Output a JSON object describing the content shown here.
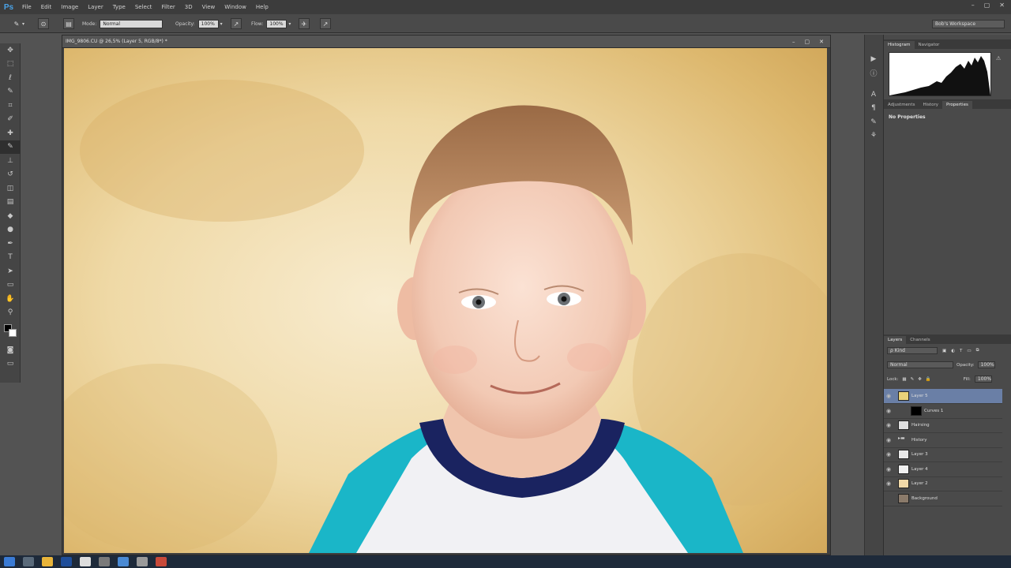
{
  "app": {
    "logo": "Ps"
  },
  "menu": [
    "File",
    "Edit",
    "Image",
    "Layer",
    "Type",
    "Select",
    "Filter",
    "3D",
    "View",
    "Window",
    "Help"
  ],
  "window_controls": [
    "–",
    "▢",
    "✕"
  ],
  "options": {
    "mode_label": "Mode:",
    "mode_value": "Normal",
    "opacity_label": "Opacity:",
    "opacity_value": "100%",
    "flow_label": "Flow:",
    "flow_value": "100%",
    "workspace": "Bob's Workspace"
  },
  "document": {
    "title": "IMG_9806.CU @ 26,5% (Layer 5, RGB/8*) *",
    "controls": [
      "–",
      "▢",
      "✕"
    ]
  },
  "tools": [
    "move-icon",
    "marquee-icon",
    "lasso-icon",
    "quick-select-icon",
    "crop-icon",
    "eyedropper-icon",
    "healing-icon",
    "brush-icon",
    "stamp-icon",
    "history-brush-icon",
    "eraser-icon",
    "gradient-icon",
    "blur-icon",
    "dodge-icon",
    "pen-icon",
    "type-icon",
    "path-select-icon",
    "shape-icon",
    "hand-icon",
    "zoom-icon"
  ],
  "tool_glyphs": [
    "✥",
    "⬚",
    "ℓ",
    "✎",
    "⌗",
    "✐",
    "✚",
    "✎",
    "⊥",
    "↺",
    "◫",
    "▤",
    "◆",
    "●",
    "✒",
    "T",
    "➤",
    "▭",
    "✋",
    "⚲"
  ],
  "histogram_panel": {
    "tabs": [
      "Histogram",
      "Navigator"
    ]
  },
  "properties_panel": {
    "tabs": [
      "Adjustments",
      "History",
      "Properties"
    ],
    "content": "No Properties"
  },
  "layers_panel": {
    "tabs": [
      "Layers",
      "Channels"
    ],
    "kind_filter": "ρ Kind",
    "blend_mode": "Normal",
    "opacity_label": "Opacity:",
    "opacity_value": "100%",
    "lock_label": "Lock:",
    "fill_label": "Fill:",
    "fill_value": "100%",
    "layers": [
      {
        "name": "Layer 5",
        "thumb": "#e9d27a",
        "selected": true
      },
      {
        "name": "Curves 1",
        "thumb": "#000000",
        "selected": false
      },
      {
        "name": "Hairsing",
        "thumb": "#dddddd",
        "selected": false
      },
      {
        "name": "History",
        "thumb": "folder",
        "selected": false
      },
      {
        "name": "Layer 3",
        "thumb": "#e8e8e8",
        "selected": false
      },
      {
        "name": "Layer 4",
        "thumb": "#f0f0f0",
        "selected": false
      },
      {
        "name": "Layer 2",
        "thumb": "#f0d8a8",
        "selected": false
      },
      {
        "name": "Background",
        "thumb": "#8a7a6a",
        "selected": false
      }
    ]
  },
  "colors": {
    "accent": "#4aa3e8",
    "shirt_teal": "#1ab6c8",
    "collar_navy": "#1a2360",
    "background_gold": "#e6c98a"
  }
}
